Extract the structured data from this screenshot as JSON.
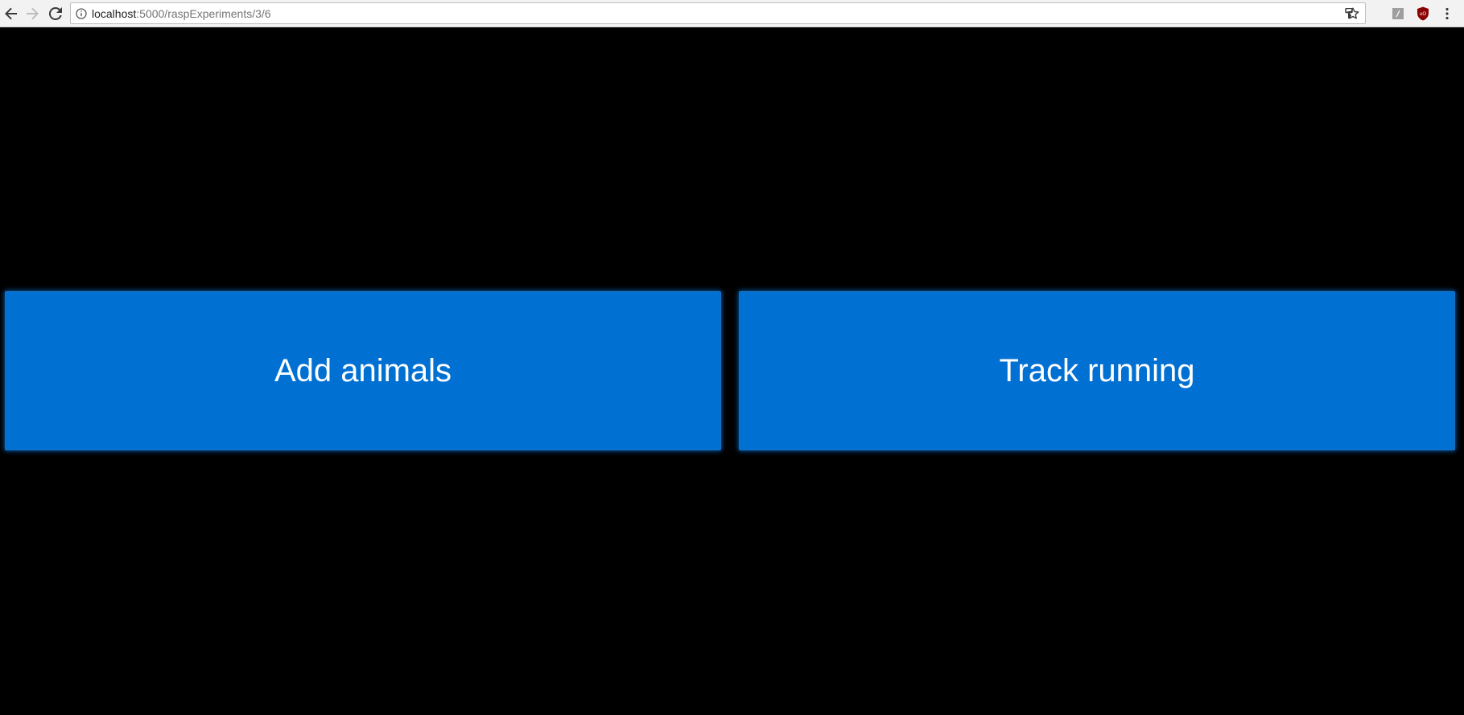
{
  "browser": {
    "url_host": "localhost",
    "url_path": ":5000/raspExperiments/3/6",
    "icons": {
      "back": "arrow-left-icon",
      "forward": "arrow-right-icon",
      "reload": "reload-icon",
      "site_info": "info-icon",
      "key": "key-icon",
      "bookmark": "star-icon",
      "extension_1": "extension-icon",
      "extension_2": "shield-icon",
      "menu": "kebab-menu-icon"
    }
  },
  "main": {
    "buttons": [
      {
        "label": "Add animals"
      },
      {
        "label": "Track running"
      }
    ]
  },
  "colors": {
    "page_background": "#000000",
    "button_background": "#0070d2",
    "button_text": "#ffffff"
  }
}
